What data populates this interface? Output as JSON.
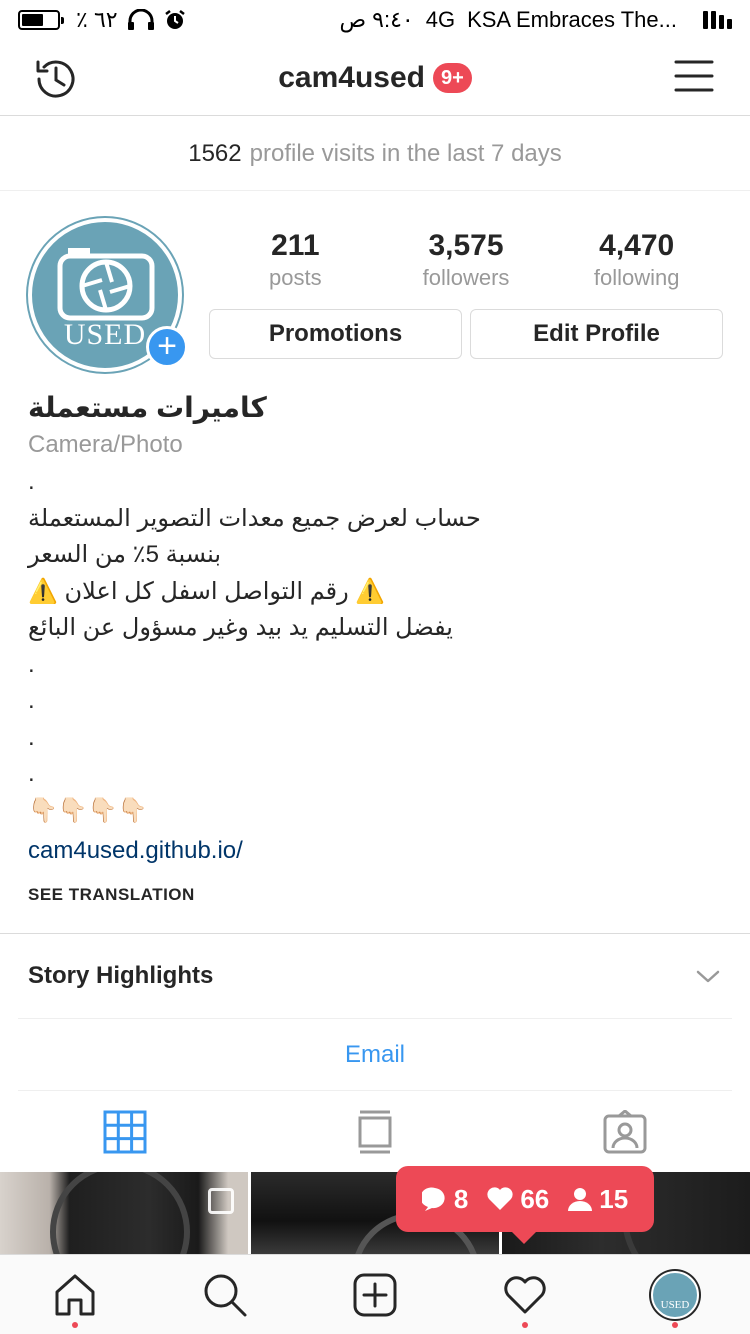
{
  "status_bar": {
    "battery_text": "٪ ٦٢",
    "time": "٩:٤٠ ص",
    "network": "4G",
    "carrier_text": "KSA Embraces The...",
    "battery_level": 0.62
  },
  "nav": {
    "username": "cam4used",
    "badge": "9+",
    "left_icon": "history-icon",
    "right_icon": "menu-icon"
  },
  "visits": {
    "count": "1562",
    "text": "profile visits in the last 7 days"
  },
  "profile": {
    "avatar_text": "USED",
    "stats": [
      {
        "num": "211",
        "label": "posts"
      },
      {
        "num": "3,575",
        "label": "followers"
      },
      {
        "num": "4,470",
        "label": "following"
      }
    ],
    "promotions_label": "Promotions",
    "edit_label": "Edit Profile"
  },
  "bio": {
    "name": "كاميرات مستعملة",
    "category": "Camera/Photo",
    "lines": [
      ".",
      "حساب لعرض جميع معدات التصوير المستعملة",
      "بنسبة 5٪ من السعر",
      "⚠️ رقم التواصل اسفل كل اعلان ⚠️",
      "يفضل التسليم يد بيد وغير مسؤول عن البائع",
      ".",
      ".",
      ".",
      ".",
      "👇🏻👇🏻👇🏻👇🏻"
    ],
    "link": "cam4used.github.io/",
    "see_translation": "SEE TRANSLATION"
  },
  "highlights": {
    "title": "Story Highlights"
  },
  "contact": {
    "email_label": "Email"
  },
  "tabs": [
    {
      "icon": "grid-icon",
      "active": true
    },
    {
      "icon": "list-feed-icon",
      "active": false
    },
    {
      "icon": "tagged-icon",
      "active": false
    }
  ],
  "notification": {
    "comments": "8",
    "likes": "66",
    "follows": "15"
  },
  "bottom_bar": [
    {
      "icon": "home-icon",
      "dot": true
    },
    {
      "icon": "search-icon",
      "dot": false
    },
    {
      "icon": "add-post-icon",
      "dot": false
    },
    {
      "icon": "activity-heart-icon",
      "dot": true
    },
    {
      "icon": "profile-avatar-icon",
      "dot": true
    }
  ],
  "colors": {
    "accent_blue": "#3897f0",
    "badge_red": "#ed4956",
    "link_blue": "#003569",
    "avatar_teal": "#6aa3b6"
  }
}
